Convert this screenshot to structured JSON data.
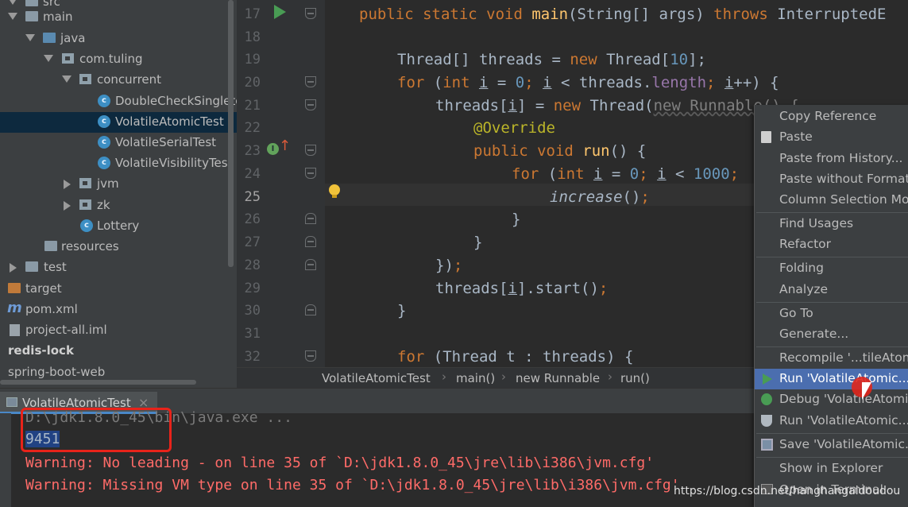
{
  "project_tree": {
    "items": [
      {
        "label": "src",
        "depth": 0
      },
      {
        "label": "main",
        "depth": 1
      },
      {
        "label": "java",
        "depth": 2
      },
      {
        "label": "com.tuling",
        "depth": 3
      },
      {
        "label": "concurrent",
        "depth": 4
      },
      {
        "label": "DoubleCheckSingleton",
        "depth": 5
      },
      {
        "label": "VolatileAtomicTest",
        "depth": 5,
        "selected": true
      },
      {
        "label": "VolatileSerialTest",
        "depth": 5
      },
      {
        "label": "VolatileVisibilityTest",
        "depth": 5
      },
      {
        "label": "jvm",
        "depth": 4
      },
      {
        "label": "zk",
        "depth": 4
      },
      {
        "label": "Lottery",
        "depth": 4
      },
      {
        "label": "resources",
        "depth": 2
      },
      {
        "label": "test",
        "depth": 1
      },
      {
        "label": "target",
        "depth": 0
      },
      {
        "label": "pom.xml",
        "depth": 0
      },
      {
        "label": "project-all.iml",
        "depth": 0
      },
      {
        "label": "redis-lock",
        "depth": 0
      },
      {
        "label": "spring-boot-web",
        "depth": 0
      }
    ]
  },
  "editor": {
    "line_numbers": [
      "17",
      "18",
      "19",
      "20",
      "21",
      "22",
      "23",
      "24",
      "25",
      "26",
      "27",
      "28",
      "29",
      "30",
      "31",
      "32"
    ],
    "lines": [
      {
        "kw1": "public static void ",
        "fn": "main",
        "rest": "(String[] args) ",
        "kw2": "throws ",
        "tail": "InterruptedE"
      },
      {},
      {
        "a": "Thread[] threads = ",
        "kw": "new ",
        "b": "Thread[",
        "num": "10",
        "c": "];"
      },
      {
        "kw": "for ",
        "a": "(",
        "kw2": "int ",
        "v": "i",
        "b": " = ",
        "num": "0",
        "c": "; ",
        "v2": "i",
        "d": " < threads.",
        "fld": "length",
        "e": "; ",
        "v3": "i",
        "f": "++) {"
      },
      {
        "a": "threads[",
        "v": "i",
        "b": "] = ",
        "kw": "new ",
        "c": "Thread(",
        "dim": "new Runnable() {"
      },
      {
        "ann": "@Override"
      },
      {
        "kw": "public void ",
        "fn": "run",
        "a": "() {"
      },
      {
        "kw": "for ",
        "a": "(",
        "kw2": "int ",
        "v": "i",
        "b": " = ",
        "num": "0",
        "c": "; ",
        "v2": "i",
        "d": " < ",
        "num2": "1000",
        "e": ";"
      },
      {
        "ital": "increase",
        "a": "()",
        "kw": ";"
      },
      {
        "a": "}"
      },
      {
        "a": "}"
      },
      {
        "a": "})",
        "kw": ";"
      },
      {
        "a": "threads[",
        "v": "i",
        "b": "].start()",
        "kw": ";"
      },
      {
        "a": "}"
      },
      {},
      {
        "kw": "for ",
        "a": "(Thread t : threads) {"
      }
    ]
  },
  "breadcrumb": [
    "VolatileAtomicTest",
    "main()",
    "new Runnable",
    "run()"
  ],
  "run_panel": {
    "tab_label": "VolatileAtomicTest",
    "tab_close": "×",
    "cmd": "D:\\jdk1.8.0_45\\bin\\java.exe ...",
    "output": "9451",
    "warnings": [
      "Warning: No leading - on line 35 of `D:\\jdk1.8.0_45\\jre\\lib\\i386\\jvm.cfg'",
      "Warning: Missing VM type on line 35 of `D:\\jdk1.8.0_45\\jre\\lib\\i386\\jvm.cfg'"
    ]
  },
  "context_menu": {
    "items": [
      {
        "label": "Copy Reference"
      },
      {
        "label": "Paste",
        "icon": "paste-icon"
      },
      {
        "label": "Paste from History..."
      },
      {
        "label": "Paste without Formatting"
      },
      {
        "label": "Column Selection Mode"
      },
      {
        "label": "Find Usages"
      },
      {
        "label": "Refactor"
      },
      {
        "label": "Folding"
      },
      {
        "label": "Analyze"
      },
      {
        "label": "Go To"
      },
      {
        "label": "Generate..."
      },
      {
        "label": "Recompile '...tileAtomicTest.java'"
      },
      {
        "label": "Run 'VolatileAtomic....main()'",
        "icon": "run-icon",
        "highlighted": true
      },
      {
        "label": "Debug 'VolatileAtomic....main()'",
        "icon": "debug-icon"
      },
      {
        "label": "Run 'VolatileAtomic....main()' with Coverage",
        "icon": "coverage-icon"
      },
      {
        "label": "Save 'VolatileAtomic....main()'",
        "icon": "save-icon"
      },
      {
        "label": "Show in Explorer"
      },
      {
        "label": "Open in Terminal",
        "icon": "terminal-icon"
      }
    ]
  },
  "watermark": "https://blog.csdn.net/hanghangaidoudou",
  "colors": {
    "accent": "#4b6eaf",
    "keyword": "#cc7832",
    "warning": "#ff6b68",
    "annotation_box": "#e8231a"
  }
}
